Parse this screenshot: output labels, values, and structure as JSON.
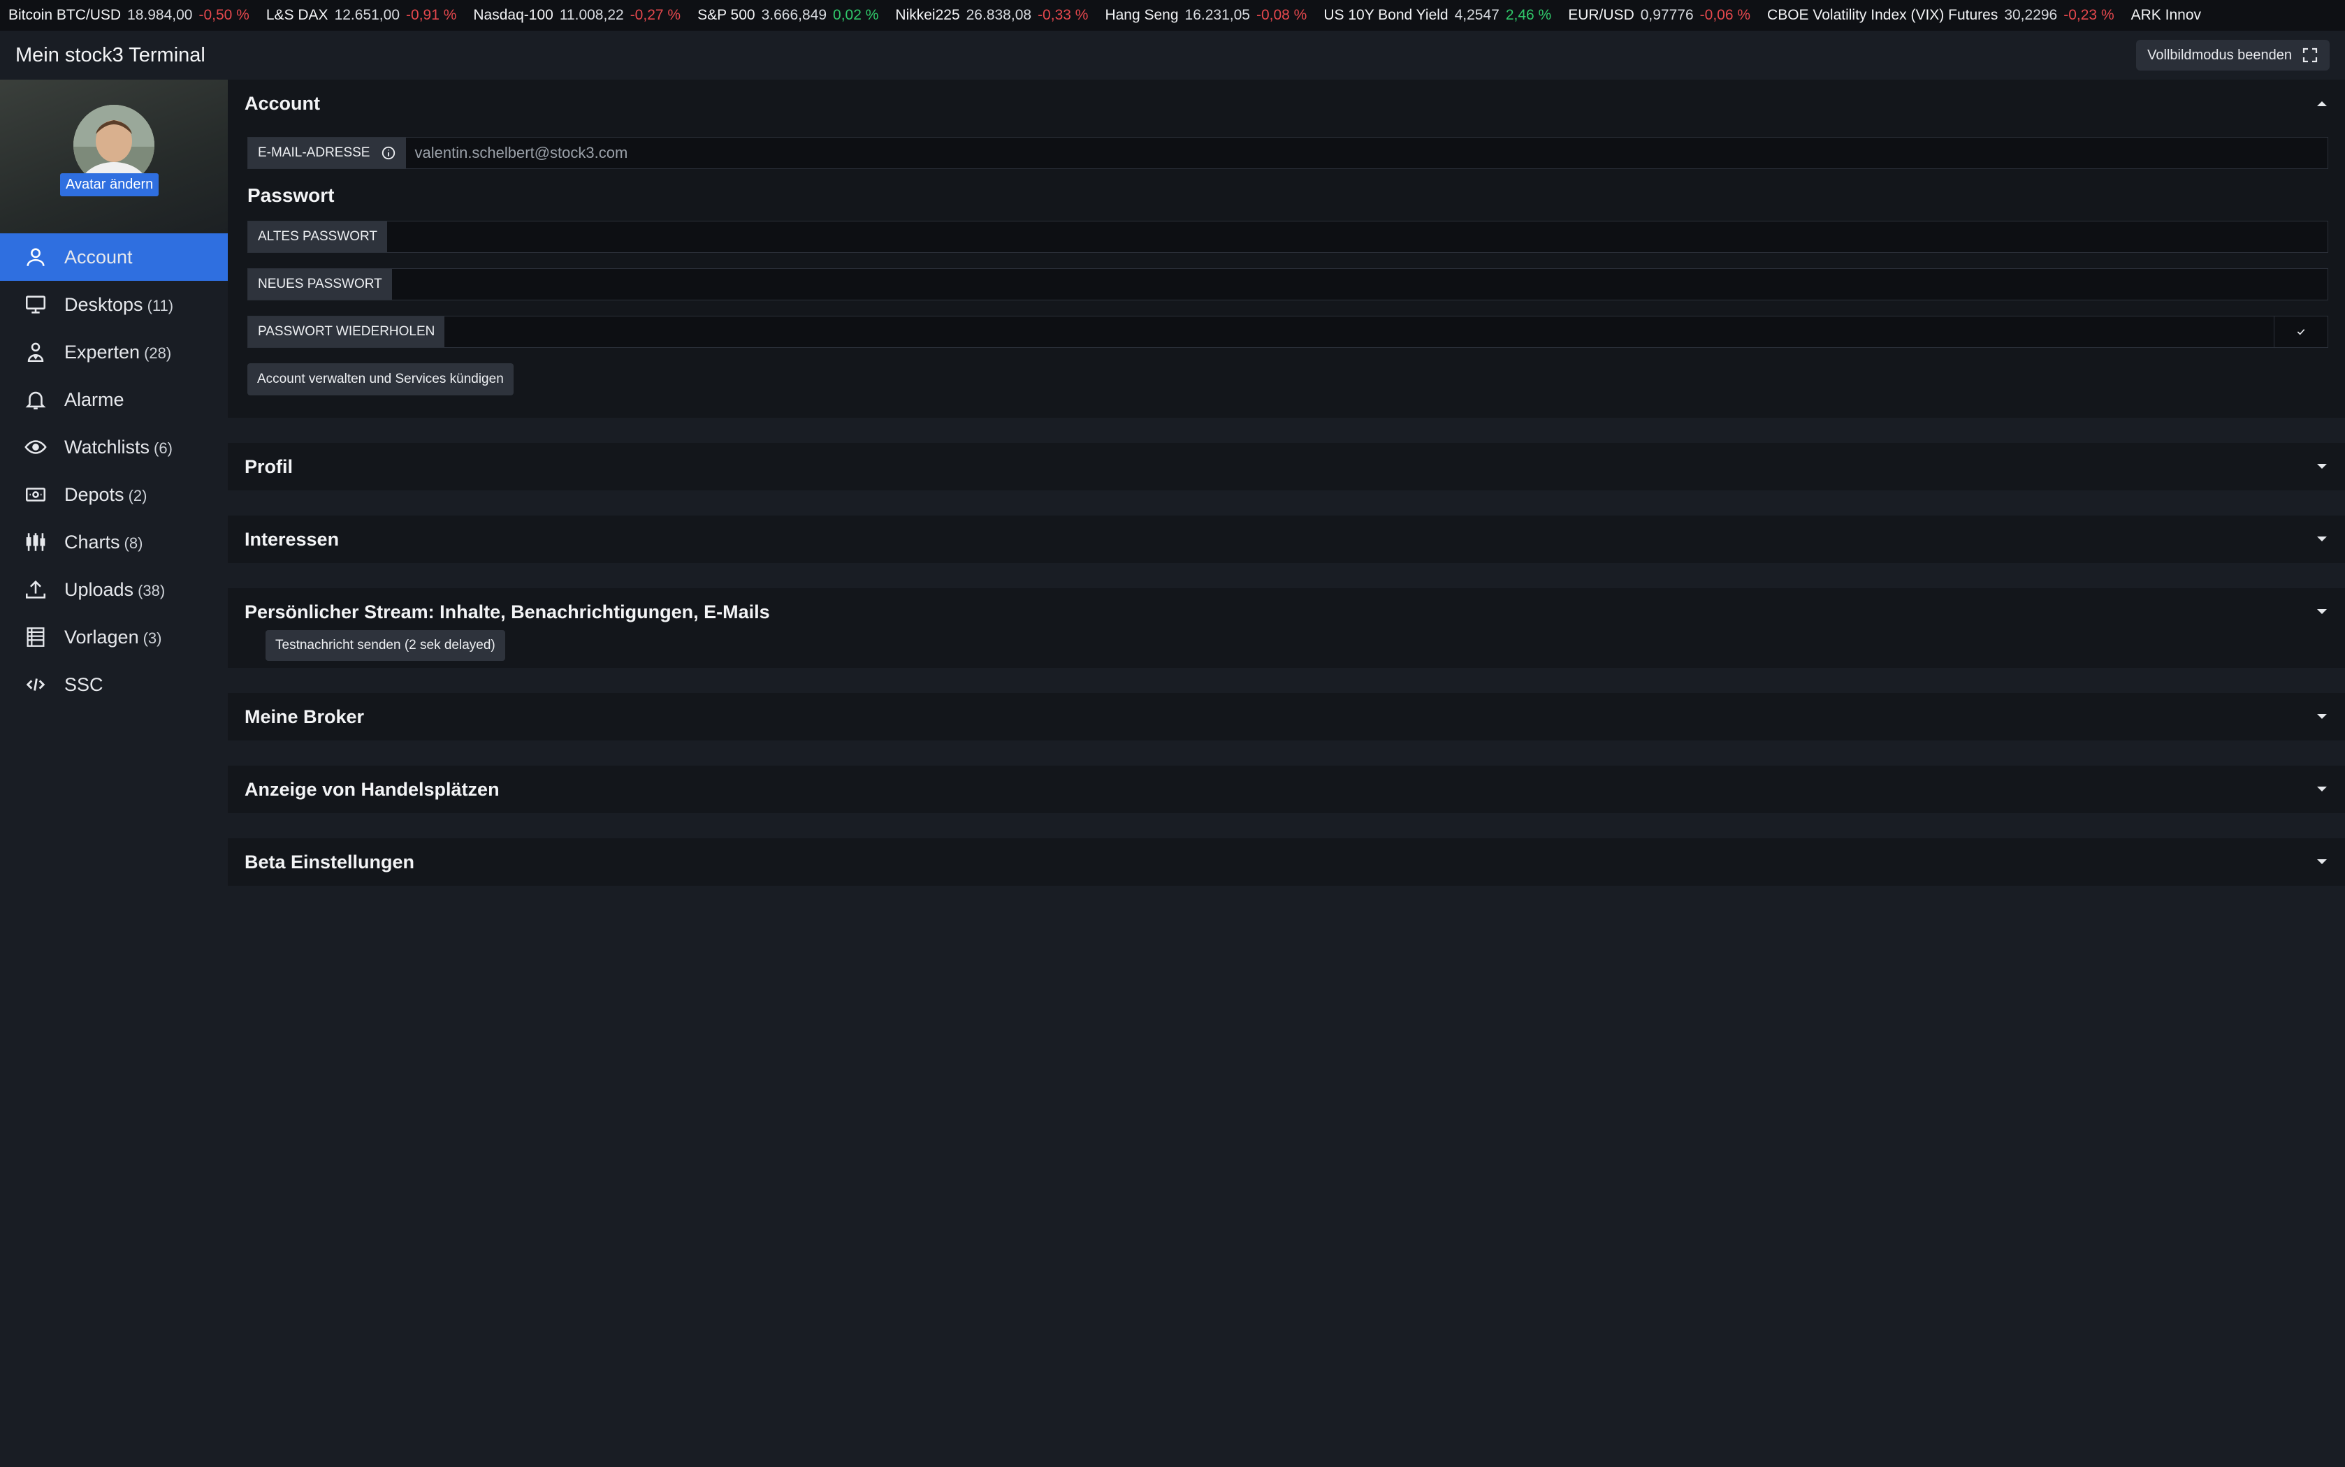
{
  "ticker": [
    {
      "name": "Bitcoin BTC/USD",
      "value": "18.984,00",
      "change": "-0,50 %",
      "dir": "neg"
    },
    {
      "name": "L&S DAX",
      "value": "12.651,00",
      "change": "-0,91 %",
      "dir": "neg"
    },
    {
      "name": "Nasdaq-100",
      "value": "11.008,22",
      "change": "-0,27 %",
      "dir": "neg"
    },
    {
      "name": "S&P 500",
      "value": "3.666,849",
      "change": "0,02 %",
      "dir": "pos"
    },
    {
      "name": "Nikkei225",
      "value": "26.838,08",
      "change": "-0,33 %",
      "dir": "neg"
    },
    {
      "name": "Hang Seng",
      "value": "16.231,05",
      "change": "-0,08 %",
      "dir": "neg"
    },
    {
      "name": "US 10Y Bond Yield",
      "value": "4,2547",
      "change": "2,46 %",
      "dir": "pos"
    },
    {
      "name": "EUR/USD",
      "value": "0,97776",
      "change": "-0,06 %",
      "dir": "neg"
    },
    {
      "name": "CBOE Volatility Index (VIX) Futures",
      "value": "30,2296",
      "change": "-0,23 %",
      "dir": "neg"
    },
    {
      "name": "ARK Innov",
      "value": "",
      "change": "",
      "dir": "neg"
    }
  ],
  "header": {
    "title": "Mein stock3 Terminal",
    "fullscreen_label": "Vollbildmodus beenden"
  },
  "sidebar": {
    "avatar_button": "Avatar ändern",
    "items": [
      {
        "label": "Account",
        "count": "",
        "icon": "user-icon",
        "active": true
      },
      {
        "label": "Desktops",
        "count": "(11)",
        "icon": "monitor-icon"
      },
      {
        "label": "Experten",
        "count": "(28)",
        "icon": "expert-icon"
      },
      {
        "label": "Alarme",
        "count": "",
        "icon": "bell-icon"
      },
      {
        "label": "Watchlists",
        "count": "(6)",
        "icon": "eye-icon"
      },
      {
        "label": "Depots",
        "count": "(2)",
        "icon": "money-icon"
      },
      {
        "label": "Charts",
        "count": "(8)",
        "icon": "candlestick-icon"
      },
      {
        "label": "Uploads",
        "count": "(38)",
        "icon": "upload-icon"
      },
      {
        "label": "Vorlagen",
        "count": "(3)",
        "icon": "template-icon"
      },
      {
        "label": "SSC",
        "count": "",
        "icon": "code-icon"
      }
    ]
  },
  "account": {
    "title": "Account",
    "email_label": "E-MAIL-ADRESSE",
    "email_value": "valentin.schelbert@stock3.com",
    "password_heading": "Passwort",
    "old_password_label": "ALTES PASSWORT",
    "new_password_label": "NEUES PASSWORT",
    "repeat_password_label": "PASSWORT WIEDERHOLEN",
    "manage_button": "Account verwalten und Services kündigen"
  },
  "sections": {
    "profil": "Profil",
    "interessen": "Interessen",
    "stream": "Persönlicher Stream: Inhalte, Benachrichtigungen, E-Mails",
    "stream_button": "Testnachricht senden (2 sek delayed)",
    "broker": "Meine Broker",
    "handelsplaetze": "Anzeige von Handelsplätzen",
    "beta": "Beta Einstellungen"
  },
  "colors": {
    "accent": "#2f6fe0",
    "negative": "#e5484d",
    "positive": "#30c86a"
  }
}
